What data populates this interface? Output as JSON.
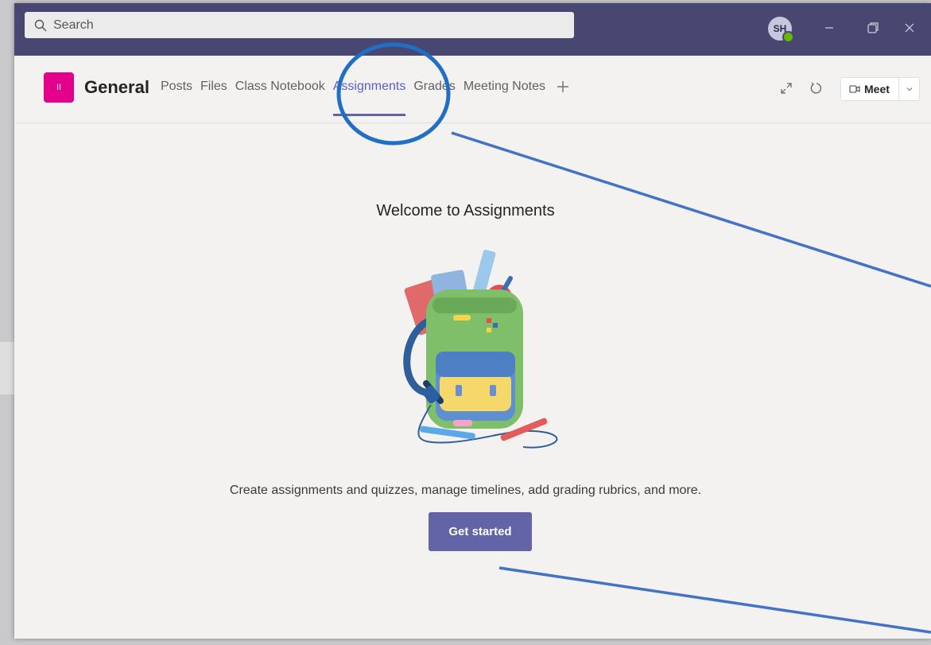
{
  "search": {
    "placeholder": "Search"
  },
  "user": {
    "initials": "SH"
  },
  "channel": {
    "name": "General",
    "team_tile_label": "II"
  },
  "tabs": [
    {
      "label": "Posts"
    },
    {
      "label": "Files"
    },
    {
      "label": "Class Notebook"
    },
    {
      "label": "Assignments"
    },
    {
      "label": "Grades"
    },
    {
      "label": "Meeting Notes"
    }
  ],
  "active_tab": "Assignments",
  "meet_button": {
    "label": "Meet"
  },
  "main": {
    "title": "Welcome to Assignments",
    "description": "Create assignments and quizzes, manage timelines, add grading rubrics, and more.",
    "cta_label": "Get started"
  },
  "icons": [
    "search-icon",
    "minimize-icon",
    "restore-icon",
    "close-icon",
    "add-tab-icon",
    "expand-icon",
    "refresh-icon",
    "video-icon",
    "chevron-down-icon",
    "backpack-illustration"
  ],
  "colors": {
    "titlebar": "#474772",
    "accent": "#6264a7",
    "team_tile": "#e3008c",
    "annotation": "#1f6fc5"
  }
}
